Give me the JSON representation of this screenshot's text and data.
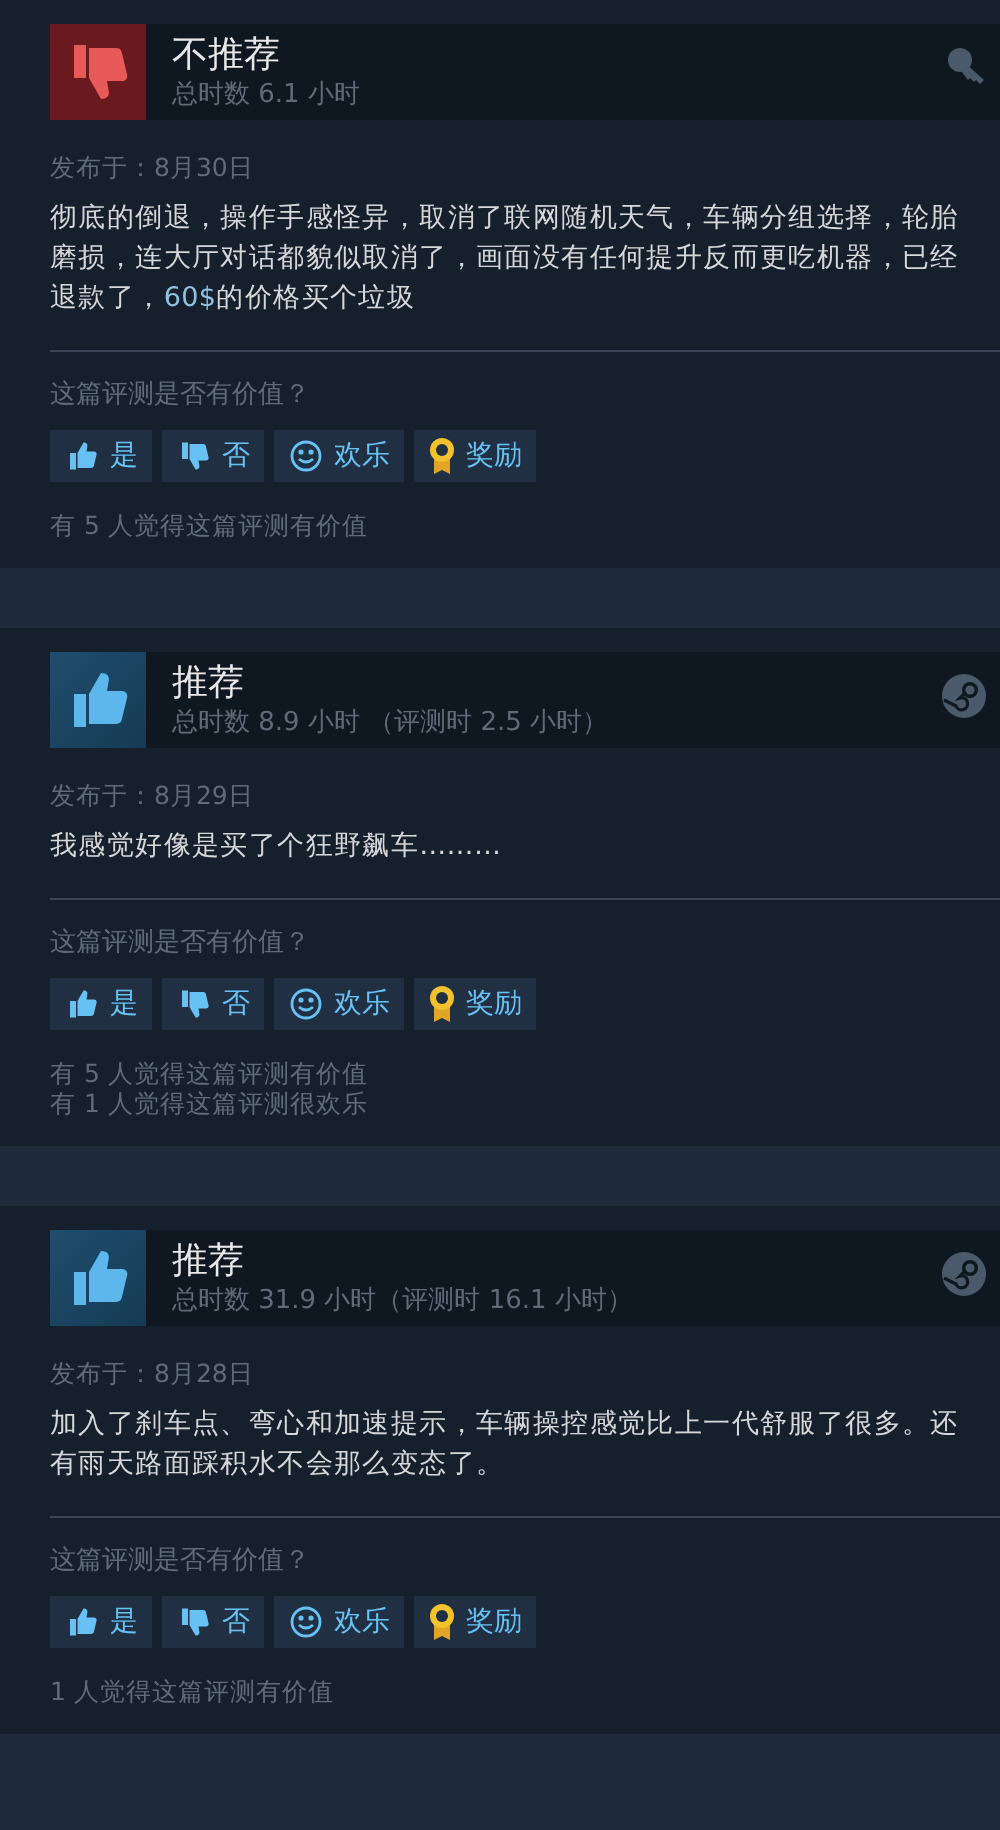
{
  "reviews": [
    {
      "recommended": false,
      "verdict": "不推荐",
      "hours": "总时数 6.1 小时",
      "kind": "key",
      "posted": "发布于：8月30日",
      "text": "彻底的倒退，操作手感怪异，取消了联网随机天气，车辆分组选择，轮胎磨损，连大厅对话都貌似取消了，画面没有任何提升反而更吃机器，已经退款了，**60$**的价格买个垃圾",
      "question": "这篇评测是否有价值？",
      "buttons": [
        {
          "kind": "yes",
          "label": "是"
        },
        {
          "kind": "no",
          "label": "否"
        },
        {
          "kind": "funny",
          "label": "欢乐"
        },
        {
          "kind": "award",
          "label": "奖励"
        }
      ],
      "tallies": [
        "有 5 人觉得这篇评测有价值"
      ]
    },
    {
      "recommended": true,
      "verdict": "推荐",
      "hours": "总时数 8.9 小时 （评测时 2.5 小时）",
      "kind": "steam",
      "posted": "发布于：8月29日",
      "text": "我感觉好像是买了个狂野飙车………",
      "question": "这篇评测是否有价值？",
      "buttons": [
        {
          "kind": "yes",
          "label": "是"
        },
        {
          "kind": "no",
          "label": "否"
        },
        {
          "kind": "funny",
          "label": "欢乐"
        },
        {
          "kind": "award",
          "label": "奖励"
        }
      ],
      "tallies": [
        "有 5 人觉得这篇评测有价值",
        "有 1 人觉得这篇评测很欢乐"
      ]
    },
    {
      "recommended": true,
      "verdict": "推荐",
      "hours": "总时数 31.9 小时（评测时 16.1 小时）",
      "kind": "steam",
      "posted": "发布于：8月28日",
      "text": "加入了刹车点、弯心和加速提示，车辆操控感觉比上一代舒服了很多。还有雨天路面踩积水不会那么变态了。",
      "question": "这篇评测是否有价值？",
      "buttons": [
        {
          "kind": "yes",
          "label": "是"
        },
        {
          "kind": "no",
          "label": "否"
        },
        {
          "kind": "funny",
          "label": "欢乐"
        },
        {
          "kind": "award",
          "label": "奖励"
        }
      ],
      "tallies": [
        "1 人觉得这篇评测有价值"
      ]
    }
  ]
}
